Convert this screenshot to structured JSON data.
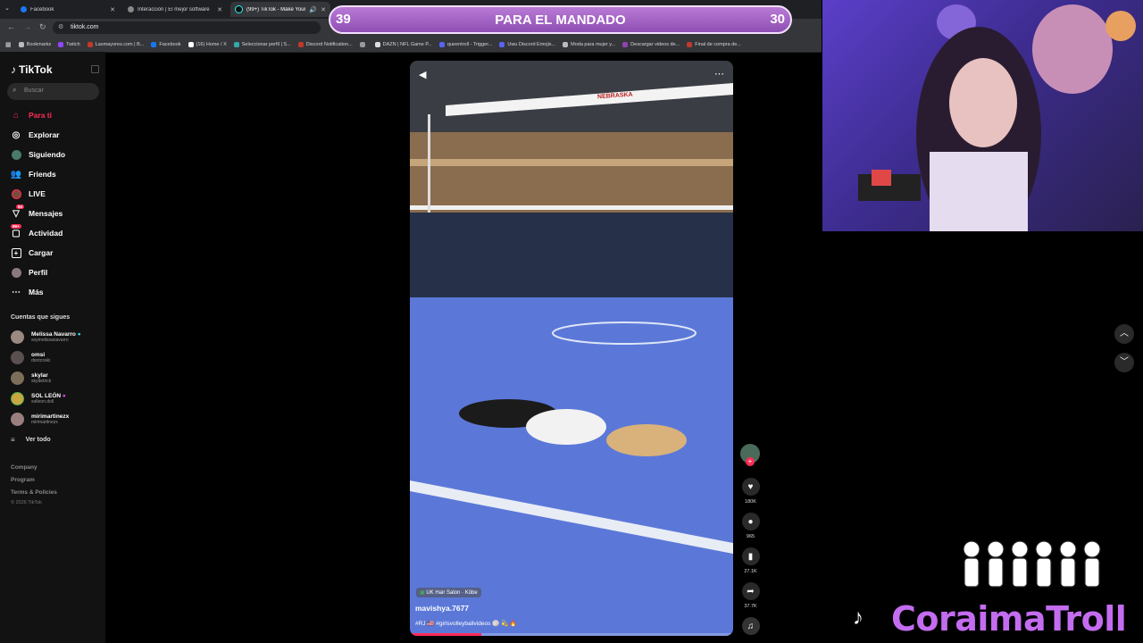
{
  "tabs": [
    {
      "label": "Facebook",
      "color": "#1877f2"
    },
    {
      "label": "Interacción | El mejor software",
      "color": "#aaaaaa"
    },
    {
      "label": "(99+) TikTok - Make Your D",
      "color": "#000000",
      "active": true
    }
  ],
  "address": {
    "url": "tiktok.com"
  },
  "bookmarks": [
    "Bookmarks",
    "Twitch",
    "Lasmayores.com | B...",
    "Facebook",
    "(16) Home / X",
    "Seleccionar perfil | S...",
    "Discord Notification...",
    "",
    "DAZN | NFL Game P...",
    "queentroll - Trigger...",
    "Uwu Discord Emojis...",
    "Moda para mujer y...",
    "Descargar videos de...",
    "Final de compra de..."
  ],
  "overlay": {
    "title": "PARA EL MANDADO",
    "left_count": "39",
    "right_count": "30"
  },
  "tiktok": {
    "logo": "TikTok",
    "search_placeholder": "Buscar",
    "nav": [
      {
        "label": "Para ti",
        "icon": "home-icon",
        "active": true
      },
      {
        "label": "Explorar",
        "icon": "compass-icon"
      },
      {
        "label": "Siguiendo",
        "icon": "following-icon"
      },
      {
        "label": "Friends",
        "icon": "friends-icon"
      },
      {
        "label": "LIVE",
        "icon": "live-icon"
      },
      {
        "label": "Mensajes",
        "icon": "messages-icon",
        "badge": "94"
      },
      {
        "label": "Actividad",
        "icon": "activity-icon",
        "badge": "99+"
      },
      {
        "label": "Cargar",
        "icon": "upload-icon"
      },
      {
        "label": "Perfil",
        "icon": "profile-icon"
      },
      {
        "label": "Más",
        "icon": "more-icon"
      }
    ],
    "following_title": "Cuentas que sigues",
    "accounts": [
      {
        "name": "Melissa Navarro",
        "handle": "soymelissanavarro",
        "verified": true
      },
      {
        "name": "omsi",
        "handle": "dontcoski"
      },
      {
        "name": "skylar",
        "handle": "skydetrick"
      },
      {
        "name": "SOL LEÓN",
        "handle": "solleon.doll",
        "verified": true
      },
      {
        "name": "mirimartinezx",
        "handle": "mirimartinezx"
      }
    ],
    "see_all": "Ver todo",
    "footer": [
      "Company",
      "Program",
      "Terms & Policies",
      "© 2026 TikTok"
    ]
  },
  "video": {
    "sponsor": "UK Hair Salon · Kōbe",
    "username": "mavishya.7677",
    "caption": "#RJ 🇺🇸 #girlsvolleyballvideos 🏐 💫 🔥",
    "progress": 0.22,
    "net_text": "NEBRASKA"
  },
  "actions": {
    "likes": "180K",
    "comments": "965",
    "saves": "27.1K",
    "shares": "37.7K"
  },
  "stream": {
    "brand": "CoraimaTroll"
  },
  "colors": {
    "accent": "#fe2c55",
    "brand_purple": "#c36cf0",
    "court": "#5b78d8"
  }
}
